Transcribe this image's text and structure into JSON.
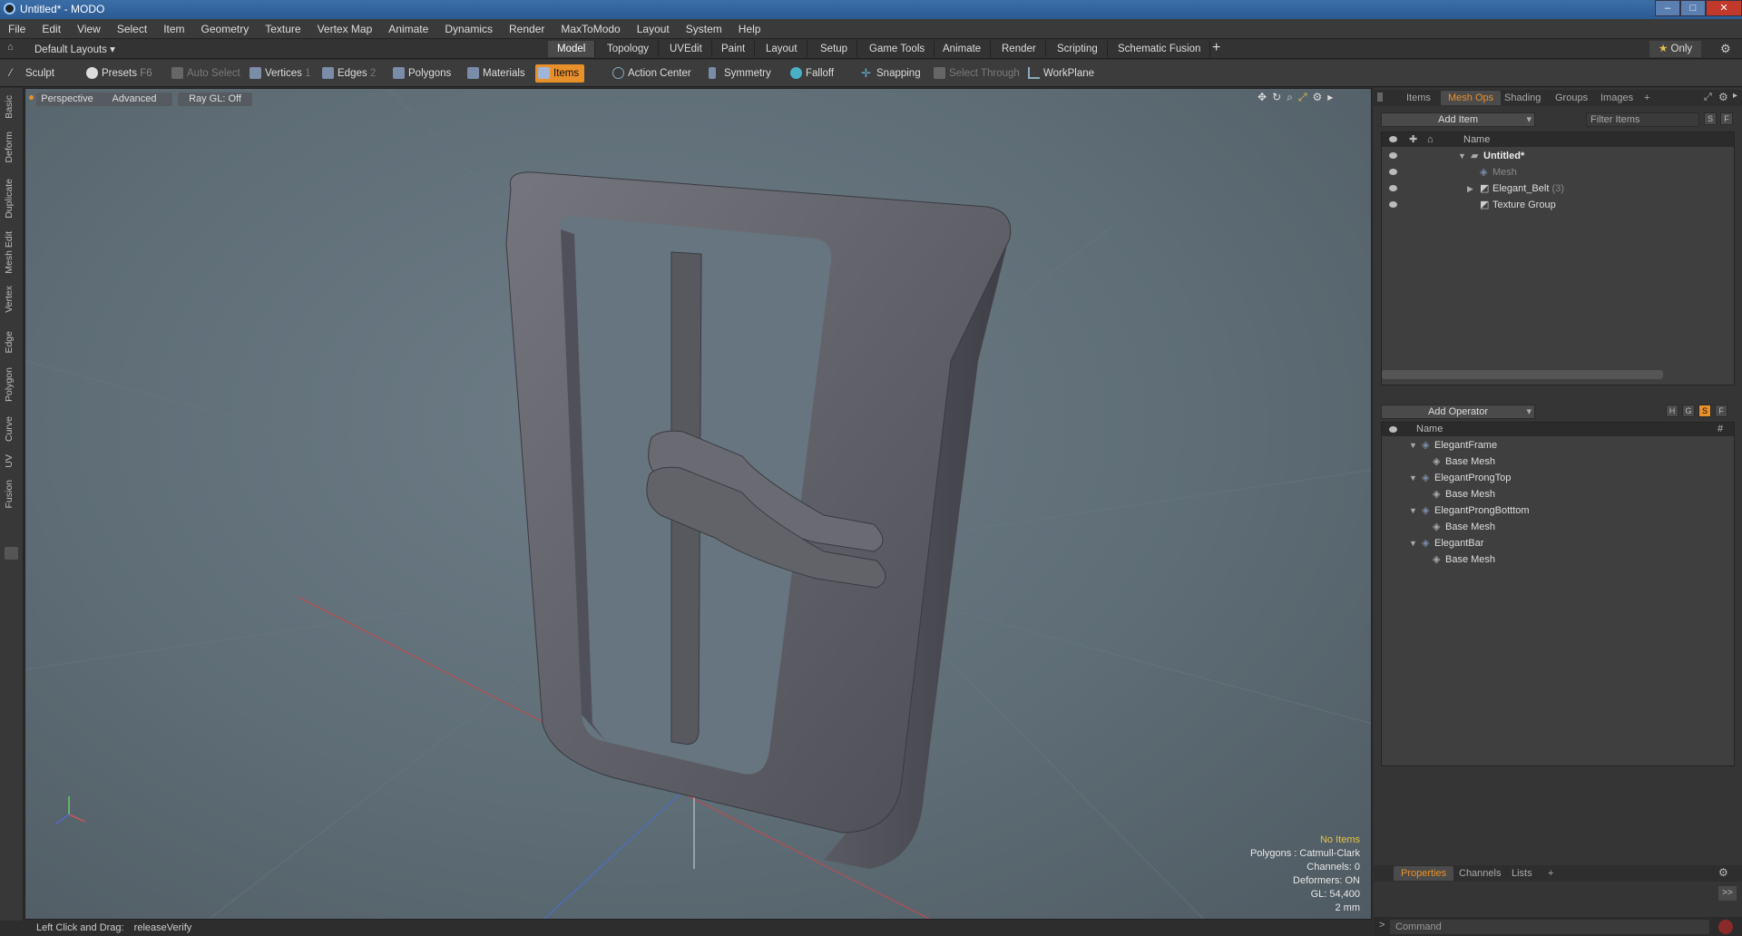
{
  "title": "Untitled* - MODO",
  "menu": [
    "File",
    "Edit",
    "View",
    "Select",
    "Item",
    "Geometry",
    "Texture",
    "Vertex Map",
    "Animate",
    "Dynamics",
    "Render",
    "MaxToModo",
    "Layout",
    "System",
    "Help"
  ],
  "layout_label": "Default Layouts",
  "tabs": [
    "Model",
    "Topology",
    "UVEdit",
    "Paint",
    "Layout",
    "Setup",
    "Game Tools",
    "Animate",
    "Render",
    "Scripting",
    "Schematic Fusion"
  ],
  "only_label": "Only",
  "toolbar": {
    "sculpt": "Sculpt",
    "presets": "Presets",
    "presets_key": "F6",
    "auto_select": "Auto Select",
    "vertices": "Vertices",
    "vertices_key": "1",
    "edges": "Edges",
    "edges_key": "2",
    "polygons": "Polygons",
    "materials": "Materials",
    "items": "Items",
    "action_center": "Action Center",
    "symmetry": "Symmetry",
    "falloff": "Falloff",
    "snapping": "Snapping",
    "select_through": "Select Through",
    "workplane": "WorkPlane"
  },
  "left_tabs": [
    "Basic",
    "Deform",
    "Duplicate",
    "Mesh Edit",
    "Vertex",
    "Edge",
    "Polygon",
    "Curve",
    "UV",
    "Fusion"
  ],
  "viewport": {
    "perspective": "Perspective",
    "advanced": "Advanced",
    "raygl": "Ray GL: Off",
    "hud": {
      "items": "No Items",
      "polygons": "Polygons : Catmull-Clark",
      "channels": "Channels: 0",
      "deformers": "Deformers: ON",
      "gl": "GL: 54,400",
      "scale": "2 mm"
    }
  },
  "status": {
    "hint": "Left Click and Drag:",
    "action": "releaseVerify"
  },
  "itemlist": {
    "tabs": [
      "Items",
      "Mesh Ops",
      "Shading",
      "Groups",
      "Images"
    ],
    "add_item": "Add Item",
    "filter": "Filter Items",
    "s": "S",
    "f": "F",
    "col_name": "Name",
    "rows": [
      {
        "label": "Untitled*",
        "bold": true
      },
      {
        "label": "Mesh",
        "dim": true
      },
      {
        "label": "Elegant_Belt",
        "count": "(3)"
      },
      {
        "label": "Texture Group"
      }
    ]
  },
  "meshops": {
    "add_operator": "Add Operator",
    "h": "H",
    "g": "G",
    "s": "S",
    "f": "F",
    "col_name": "Name",
    "col_hash": "#",
    "rows": [
      {
        "label": "ElegantFrame",
        "child": false
      },
      {
        "label": "Base Mesh",
        "child": true
      },
      {
        "label": "ElegantProngTop",
        "child": false
      },
      {
        "label": "Base Mesh",
        "child": true
      },
      {
        "label": "ElegantProngBotttom",
        "child": false
      },
      {
        "label": "Base Mesh",
        "child": true
      },
      {
        "label": "ElegantBar",
        "child": false
      },
      {
        "label": "Base Mesh",
        "child": true
      }
    ]
  },
  "properties": {
    "tabs": [
      "Properties",
      "Channels",
      "Lists"
    ],
    "command": "Command",
    "expand": ">>"
  },
  "colors": {
    "accent": "#e8902a",
    "selected_tab": "#e8902a",
    "viewport_bg": "#5e6d76"
  }
}
